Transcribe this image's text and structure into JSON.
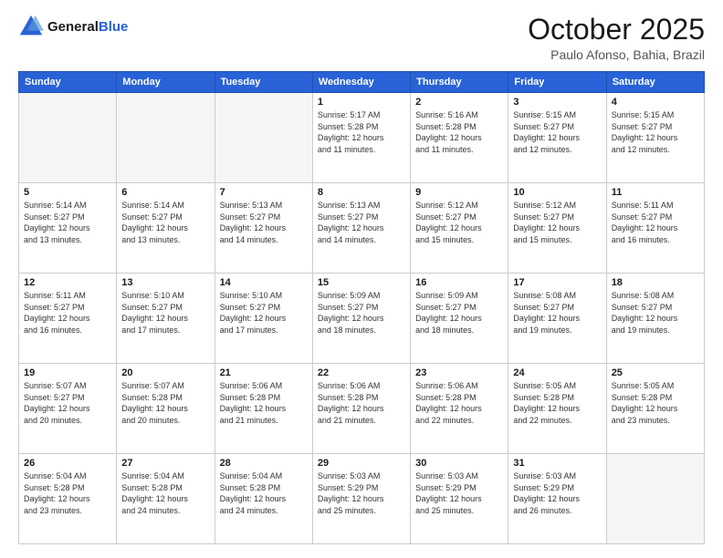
{
  "header": {
    "logo_line1": "General",
    "logo_line2": "Blue",
    "title": "October 2025",
    "subtitle": "Paulo Afonso, Bahia, Brazil"
  },
  "weekdays": [
    "Sunday",
    "Monday",
    "Tuesday",
    "Wednesday",
    "Thursday",
    "Friday",
    "Saturday"
  ],
  "weeks": [
    [
      {
        "day": "",
        "info": ""
      },
      {
        "day": "",
        "info": ""
      },
      {
        "day": "",
        "info": ""
      },
      {
        "day": "1",
        "info": "Sunrise: 5:17 AM\nSunset: 5:28 PM\nDaylight: 12 hours\nand 11 minutes."
      },
      {
        "day": "2",
        "info": "Sunrise: 5:16 AM\nSunset: 5:28 PM\nDaylight: 12 hours\nand 11 minutes."
      },
      {
        "day": "3",
        "info": "Sunrise: 5:15 AM\nSunset: 5:27 PM\nDaylight: 12 hours\nand 12 minutes."
      },
      {
        "day": "4",
        "info": "Sunrise: 5:15 AM\nSunset: 5:27 PM\nDaylight: 12 hours\nand 12 minutes."
      }
    ],
    [
      {
        "day": "5",
        "info": "Sunrise: 5:14 AM\nSunset: 5:27 PM\nDaylight: 12 hours\nand 13 minutes."
      },
      {
        "day": "6",
        "info": "Sunrise: 5:14 AM\nSunset: 5:27 PM\nDaylight: 12 hours\nand 13 minutes."
      },
      {
        "day": "7",
        "info": "Sunrise: 5:13 AM\nSunset: 5:27 PM\nDaylight: 12 hours\nand 14 minutes."
      },
      {
        "day": "8",
        "info": "Sunrise: 5:13 AM\nSunset: 5:27 PM\nDaylight: 12 hours\nand 14 minutes."
      },
      {
        "day": "9",
        "info": "Sunrise: 5:12 AM\nSunset: 5:27 PM\nDaylight: 12 hours\nand 15 minutes."
      },
      {
        "day": "10",
        "info": "Sunrise: 5:12 AM\nSunset: 5:27 PM\nDaylight: 12 hours\nand 15 minutes."
      },
      {
        "day": "11",
        "info": "Sunrise: 5:11 AM\nSunset: 5:27 PM\nDaylight: 12 hours\nand 16 minutes."
      }
    ],
    [
      {
        "day": "12",
        "info": "Sunrise: 5:11 AM\nSunset: 5:27 PM\nDaylight: 12 hours\nand 16 minutes."
      },
      {
        "day": "13",
        "info": "Sunrise: 5:10 AM\nSunset: 5:27 PM\nDaylight: 12 hours\nand 17 minutes."
      },
      {
        "day": "14",
        "info": "Sunrise: 5:10 AM\nSunset: 5:27 PM\nDaylight: 12 hours\nand 17 minutes."
      },
      {
        "day": "15",
        "info": "Sunrise: 5:09 AM\nSunset: 5:27 PM\nDaylight: 12 hours\nand 18 minutes."
      },
      {
        "day": "16",
        "info": "Sunrise: 5:09 AM\nSunset: 5:27 PM\nDaylight: 12 hours\nand 18 minutes."
      },
      {
        "day": "17",
        "info": "Sunrise: 5:08 AM\nSunset: 5:27 PM\nDaylight: 12 hours\nand 19 minutes."
      },
      {
        "day": "18",
        "info": "Sunrise: 5:08 AM\nSunset: 5:27 PM\nDaylight: 12 hours\nand 19 minutes."
      }
    ],
    [
      {
        "day": "19",
        "info": "Sunrise: 5:07 AM\nSunset: 5:27 PM\nDaylight: 12 hours\nand 20 minutes."
      },
      {
        "day": "20",
        "info": "Sunrise: 5:07 AM\nSunset: 5:28 PM\nDaylight: 12 hours\nand 20 minutes."
      },
      {
        "day": "21",
        "info": "Sunrise: 5:06 AM\nSunset: 5:28 PM\nDaylight: 12 hours\nand 21 minutes."
      },
      {
        "day": "22",
        "info": "Sunrise: 5:06 AM\nSunset: 5:28 PM\nDaylight: 12 hours\nand 21 minutes."
      },
      {
        "day": "23",
        "info": "Sunrise: 5:06 AM\nSunset: 5:28 PM\nDaylight: 12 hours\nand 22 minutes."
      },
      {
        "day": "24",
        "info": "Sunrise: 5:05 AM\nSunset: 5:28 PM\nDaylight: 12 hours\nand 22 minutes."
      },
      {
        "day": "25",
        "info": "Sunrise: 5:05 AM\nSunset: 5:28 PM\nDaylight: 12 hours\nand 23 minutes."
      }
    ],
    [
      {
        "day": "26",
        "info": "Sunrise: 5:04 AM\nSunset: 5:28 PM\nDaylight: 12 hours\nand 23 minutes."
      },
      {
        "day": "27",
        "info": "Sunrise: 5:04 AM\nSunset: 5:28 PM\nDaylight: 12 hours\nand 24 minutes."
      },
      {
        "day": "28",
        "info": "Sunrise: 5:04 AM\nSunset: 5:28 PM\nDaylight: 12 hours\nand 24 minutes."
      },
      {
        "day": "29",
        "info": "Sunrise: 5:03 AM\nSunset: 5:29 PM\nDaylight: 12 hours\nand 25 minutes."
      },
      {
        "day": "30",
        "info": "Sunrise: 5:03 AM\nSunset: 5:29 PM\nDaylight: 12 hours\nand 25 minutes."
      },
      {
        "day": "31",
        "info": "Sunrise: 5:03 AM\nSunset: 5:29 PM\nDaylight: 12 hours\nand 26 minutes."
      },
      {
        "day": "",
        "info": ""
      }
    ]
  ]
}
